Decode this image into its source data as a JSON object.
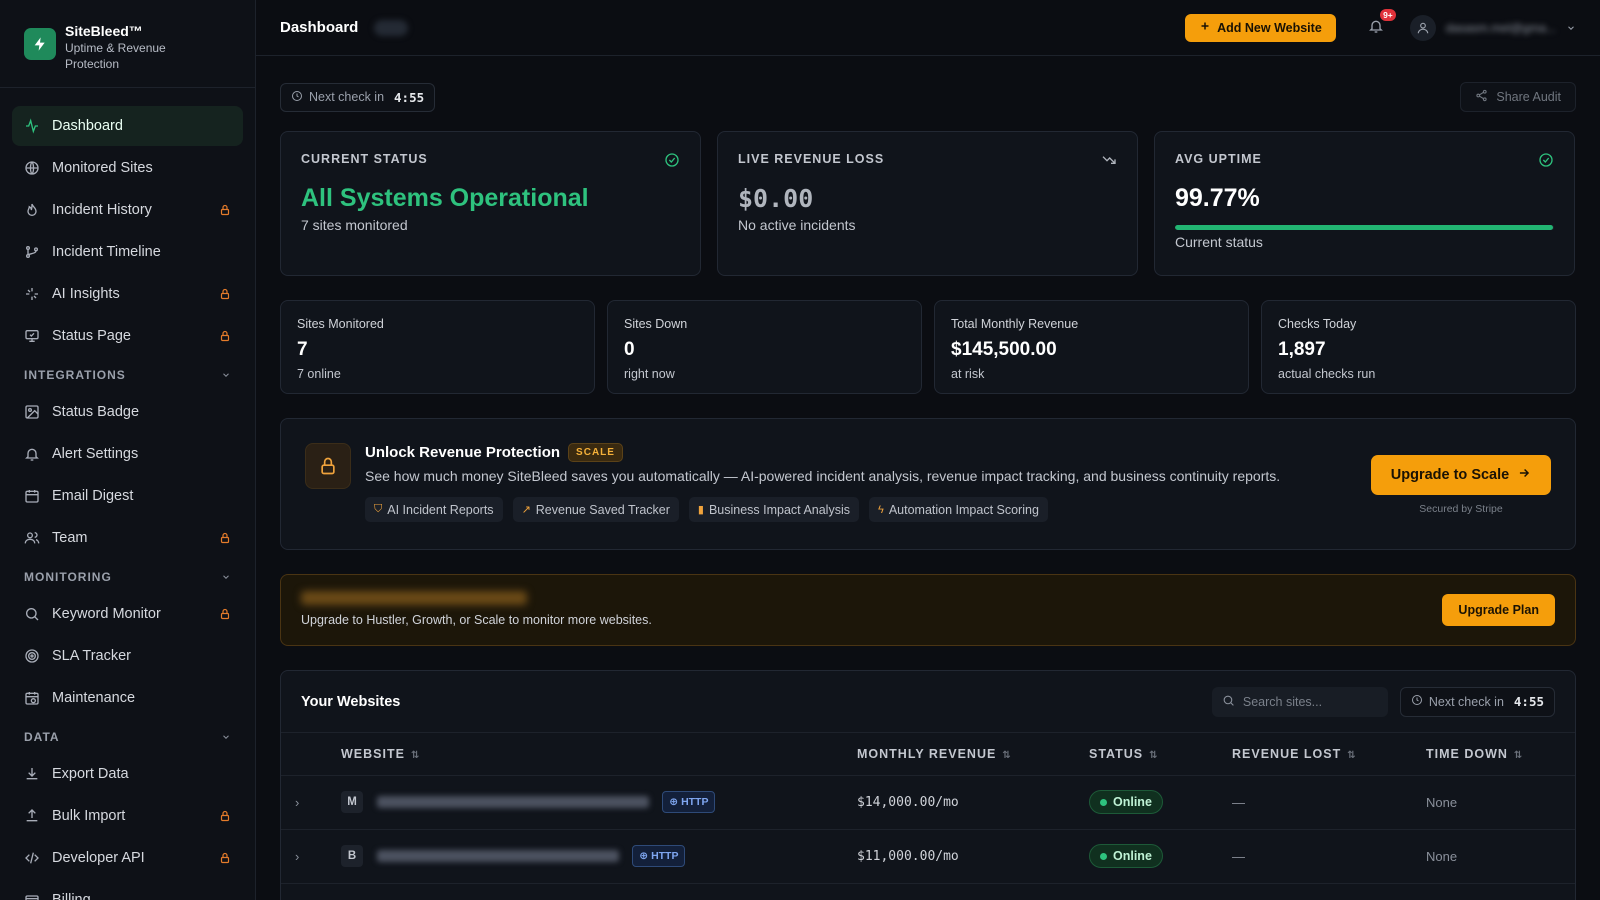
{
  "brand": {
    "name": "SiteBleed™",
    "tagline": "Uptime & Revenue Protection"
  },
  "sidebar": {
    "items": [
      {
        "label": "Dashboard",
        "icon": "activity-icon",
        "locked": false,
        "active": true
      },
      {
        "label": "Monitored Sites",
        "icon": "globe-icon",
        "locked": false
      },
      {
        "label": "Incident History",
        "icon": "flame-icon",
        "locked": true
      },
      {
        "label": "Incident Timeline",
        "icon": "git-branch-icon",
        "locked": false
      },
      {
        "label": "AI Insights",
        "icon": "sparkles-icon",
        "locked": true
      },
      {
        "label": "Status Page",
        "icon": "monitor-check-icon",
        "locked": true
      }
    ],
    "sections": {
      "integrations": {
        "label": "INTEGRATIONS",
        "items": [
          {
            "label": "Status Badge",
            "icon": "image-icon",
            "locked": false
          },
          {
            "label": "Alert Settings",
            "icon": "bell-icon",
            "locked": false
          },
          {
            "label": "Email Digest",
            "icon": "calendar-icon",
            "locked": false
          },
          {
            "label": "Team",
            "icon": "users-icon",
            "locked": true
          }
        ]
      },
      "monitoring": {
        "label": "MONITORING",
        "items": [
          {
            "label": "Keyword Monitor",
            "icon": "search-icon",
            "locked": true
          },
          {
            "label": "SLA Tracker",
            "icon": "target-icon",
            "locked": false
          },
          {
            "label": "Maintenance",
            "icon": "calendar-clock-icon",
            "locked": false
          }
        ]
      },
      "data": {
        "label": "DATA",
        "items": [
          {
            "label": "Export Data",
            "icon": "download-icon",
            "locked": false
          },
          {
            "label": "Bulk Import",
            "icon": "upload-icon",
            "locked": true
          },
          {
            "label": "Developer API",
            "icon": "code-icon",
            "locked": true
          },
          {
            "label": "Billing",
            "icon": "credit-card-icon",
            "locked": false
          }
        ]
      }
    }
  },
  "topbar": {
    "title": "Dashboard",
    "add_button": "Add New Website",
    "notifications_badge": "9+",
    "user_email": "dasasm.mel@gma..."
  },
  "toolbar": {
    "next_check_label": "Next check in",
    "next_check_value": "4:55",
    "share_label": "Share Audit"
  },
  "status_cards": [
    {
      "label": "CURRENT STATUS",
      "value": "All Systems Operational",
      "sub": "7 sites monitored",
      "icon": "check-circle-icon"
    },
    {
      "label": "LIVE REVENUE LOSS",
      "value": "$0.00",
      "sub": "No active incidents",
      "icon": "trending-down-icon"
    },
    {
      "label": "AVG UPTIME",
      "value": "99.77%",
      "sub": "Current status",
      "icon": "check-circle-icon",
      "progress": 0.9977
    }
  ],
  "stats": [
    {
      "label": "Sites Monitored",
      "value": "7",
      "sub": "7 online"
    },
    {
      "label": "Sites Down",
      "value": "0",
      "sub": "right now"
    },
    {
      "label": "Total Monthly Revenue",
      "value": "$145,500.00",
      "sub": "at risk"
    },
    {
      "label": "Checks Today",
      "value": "1,897",
      "sub": "actual checks run"
    }
  ],
  "promo": {
    "title": "Unlock Revenue Protection",
    "badge": "SCALE",
    "description": "See how much money SiteBleed saves you automatically — AI-powered incident analysis, revenue impact tracking, and business continuity reports.",
    "features": [
      {
        "label": "AI Incident Reports",
        "icon": "shield-icon"
      },
      {
        "label": "Revenue Saved Tracker",
        "icon": "trending-up-icon"
      },
      {
        "label": "Business Impact Analysis",
        "icon": "bar-chart-icon"
      },
      {
        "label": "Automation Impact Scoring",
        "icon": "bolt-icon"
      }
    ],
    "cta": "Upgrade to Scale",
    "secured": "Secured by Stripe"
  },
  "limit_banner": {
    "text": "Upgrade to Hustler, Growth, or Scale to monitor more websites.",
    "button": "Upgrade Plan"
  },
  "websites": {
    "title": "Your Websites",
    "search_placeholder": "Search sites...",
    "columns": [
      "WEBSITE",
      "MONTHLY REVENUE",
      "STATUS",
      "REVENUE LOST",
      "TIME DOWN"
    ],
    "rows": [
      {
        "initial": "M",
        "protocol": "HTTP",
        "revenue": "$14,000.00/mo",
        "status": "Online",
        "lost": "—",
        "down": "None"
      },
      {
        "initial": "B",
        "protocol": "HTTP",
        "revenue": "$11,000.00/mo",
        "status": "Online",
        "lost": "—",
        "down": "None"
      }
    ]
  },
  "colors": {
    "accent": "#f59e0b",
    "success": "#2ec27e",
    "background": "#0b0d12",
    "lock": "#e57c2b"
  }
}
